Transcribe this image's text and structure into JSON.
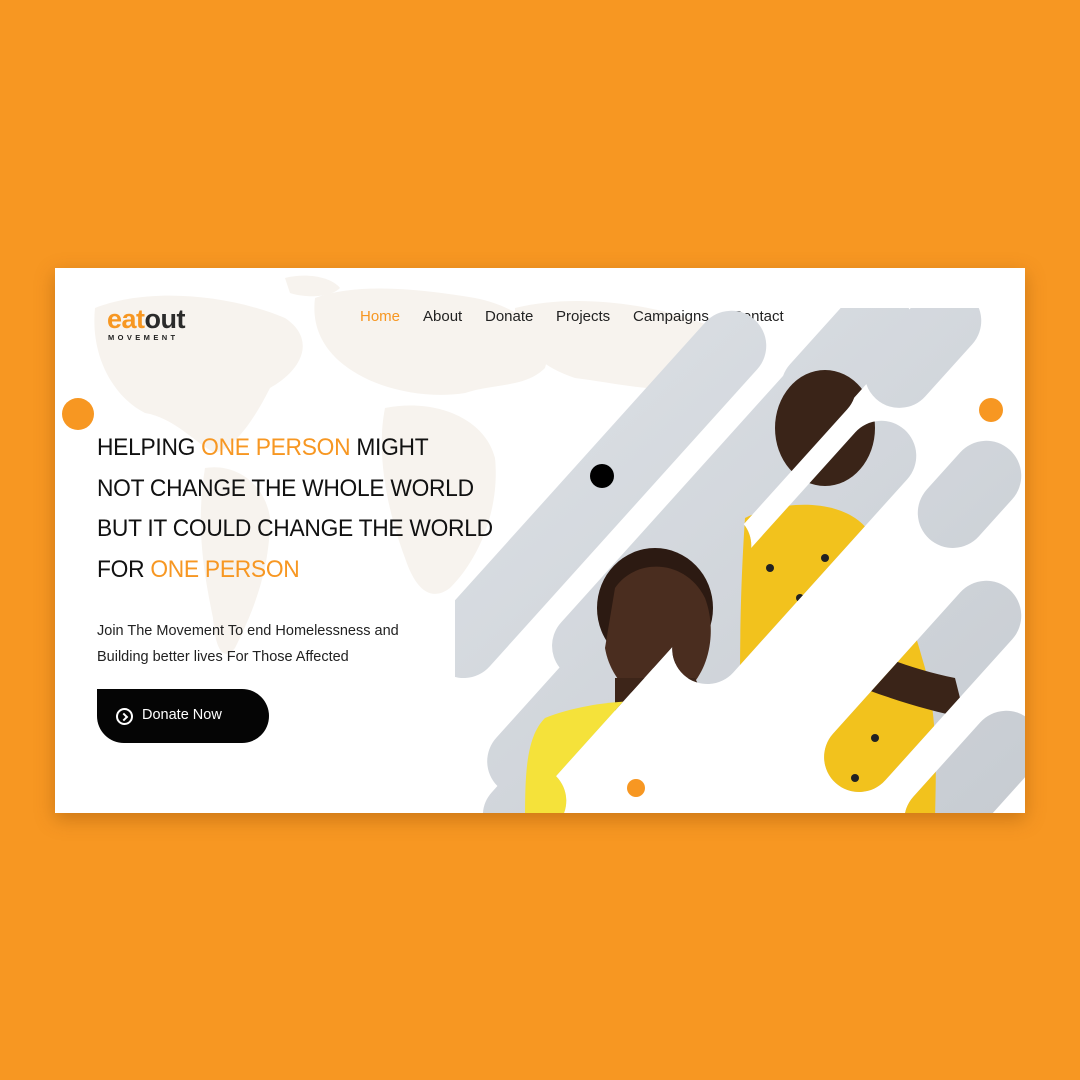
{
  "logo": {
    "text_prefix": "ea",
    "text_mark": "t",
    "text_suffix": "out",
    "subtitle": "MOVEMENT"
  },
  "nav": {
    "items": [
      {
        "label": "Home",
        "active": true
      },
      {
        "label": "About",
        "active": false
      },
      {
        "label": "Donate",
        "active": false
      },
      {
        "label": "Projects",
        "active": false
      },
      {
        "label": "Campaigns",
        "active": false
      },
      {
        "label": "Contact",
        "active": false
      }
    ]
  },
  "hero": {
    "line1_a": "HELPING ",
    "line1_hl": "ONE PERSON",
    "line1_b": " MIGHT",
    "line2": "NOT CHANGE THE WHOLE WORLD",
    "line3": "BUT IT COULD CHANGE THE WORLD",
    "line4_a": "FOR ",
    "line4_hl": "ONE PERSON",
    "subtitle_line1": "Join The Movement To end Homelessness and",
    "subtitle_line2": "Building better lives For Those Affected",
    "cta_label": "Donate Now"
  },
  "colors": {
    "page_bg": "#F79722",
    "accent": "#F79722",
    "button_bg": "#050505",
    "text": "#111111"
  },
  "icons": {
    "cta_icon": "chevron-circle-right-icon"
  }
}
